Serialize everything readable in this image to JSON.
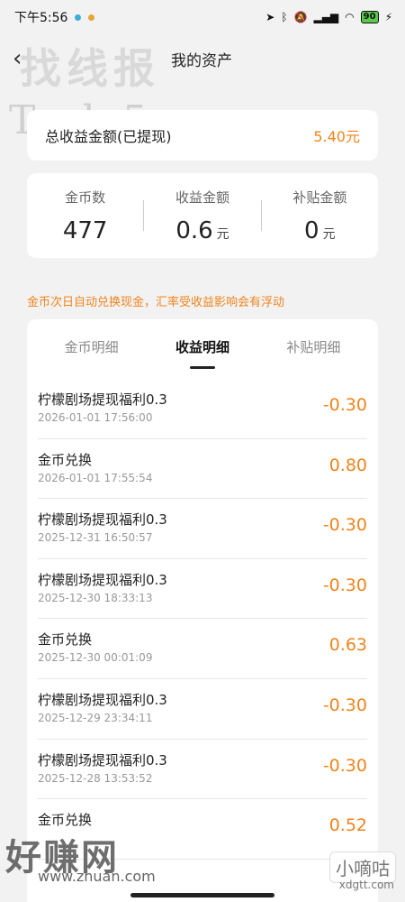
{
  "status_bar": {
    "time": "下午5:56",
    "battery": "90",
    "colors": {
      "dot1": "#3aaed8",
      "dot2": "#e8a33a",
      "battery": "#5ac84b"
    }
  },
  "nav": {
    "title": "我的资产",
    "back_icon": "chevron-left-icon"
  },
  "watermarks": {
    "top": "找线报",
    "top2": "Taolu5.com",
    "bottom": "好赚网",
    "bottom_url": "www.zhuan.com",
    "bottom_right": "小嘀咕",
    "bottom_right_url": "xdgtt.com"
  },
  "total": {
    "label": "总收益金额(已提现)",
    "value": "5.40元"
  },
  "stats": [
    {
      "label": "金币数",
      "value": "477",
      "unit": ""
    },
    {
      "label": "收益金额",
      "value": "0.6",
      "unit": "元"
    },
    {
      "label": "补贴金额",
      "value": "0",
      "unit": "元"
    }
  ],
  "notice": "金币次日自动兑换现金，汇率受收益影响会有浮动",
  "tabs": [
    "金币明细",
    "收益明细",
    "补贴明细"
  ],
  "active_tab": "收益明细",
  "records": [
    {
      "title": "柠檬剧场提现福利0.3",
      "time": "2026-01-01 17:56:00",
      "amount": "-0.30"
    },
    {
      "title": "金币兑换",
      "time": "2026-01-01 17:55:54",
      "amount": "0.80"
    },
    {
      "title": "柠檬剧场提现福利0.3",
      "time": "2025-12-31 16:50:57",
      "amount": "-0.30"
    },
    {
      "title": "柠檬剧场提现福利0.3",
      "time": "2025-12-30 18:33:13",
      "amount": "-0.30"
    },
    {
      "title": "金币兑换",
      "time": "2025-12-30 00:01:09",
      "amount": "0.63"
    },
    {
      "title": "柠檬剧场提现福利0.3",
      "time": "2025-12-29 23:34:11",
      "amount": "-0.30"
    },
    {
      "title": "柠檬剧场提现福利0.3",
      "time": "2025-12-28 13:53:52",
      "amount": "-0.30"
    },
    {
      "title": "金币兑换",
      "time": "",
      "amount": "0.52"
    }
  ],
  "accent_color": "#f0841c"
}
